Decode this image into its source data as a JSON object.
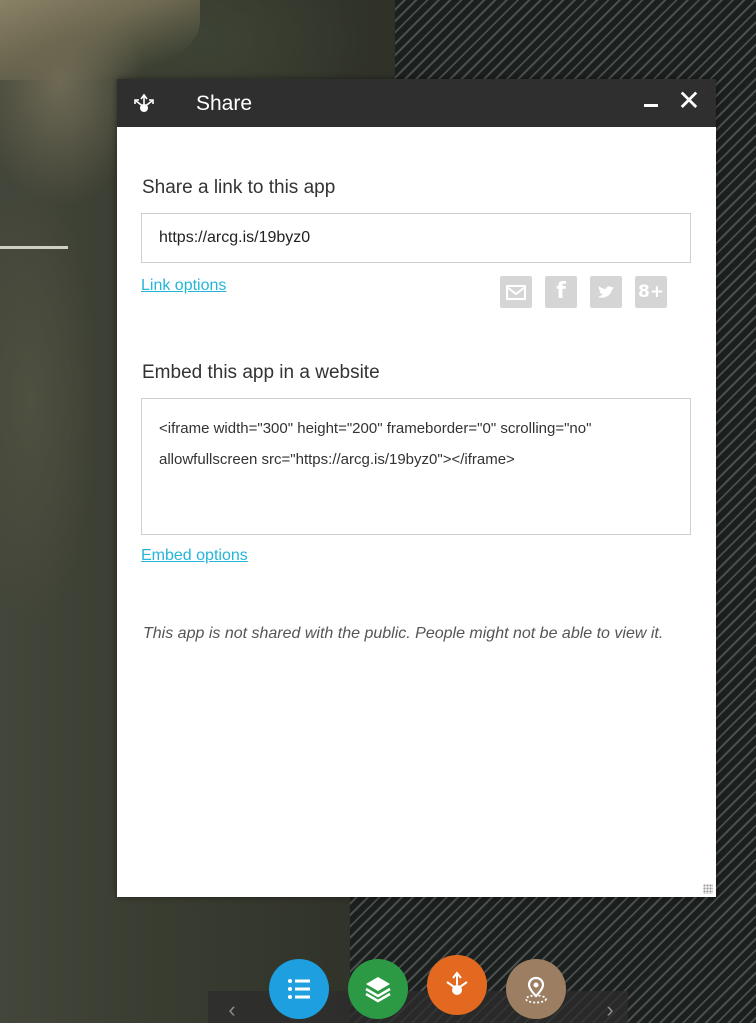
{
  "panel": {
    "title": "Share",
    "title_icon": "share-icon",
    "minimize_label": "–",
    "close_label": "✕"
  },
  "share_link": {
    "heading": "Share a link to this app",
    "url": "https://arcg.is/19byz0",
    "options_label": "Link options"
  },
  "social": [
    {
      "name": "email-icon",
      "glyph": "✉"
    },
    {
      "name": "facebook-icon",
      "glyph": "f"
    },
    {
      "name": "twitter-icon",
      "glyph": "t"
    },
    {
      "name": "google-plus-icon",
      "glyph": "8+"
    }
  ],
  "embed": {
    "heading": "Embed this app in a website",
    "code": "<iframe width=\"300\" height=\"200\" frameborder=\"0\" scrolling=\"no\" allowfullscreen src=\"https://arcg.is/19byz0\"></iframe>",
    "options_label": "Embed options"
  },
  "notice": "This app is not shared with the public. People might not be able to view it.",
  "toolbar": {
    "prev_label": "‹",
    "next_label": "›",
    "buttons": [
      {
        "name": "legend-button",
        "icon": "list-icon",
        "color": "#1e9fe0"
      },
      {
        "name": "layers-button",
        "icon": "layers-icon",
        "color": "#2c9a45"
      },
      {
        "name": "share-button",
        "icon": "share-icon",
        "color": "#e2691f"
      },
      {
        "name": "locate-button",
        "icon": "location-icon",
        "color": "#9c7f62"
      }
    ]
  },
  "colors": {
    "titlebar": "#2f2f2f",
    "link": "#24b5d8",
    "social_bg": "#d5d5d5"
  }
}
